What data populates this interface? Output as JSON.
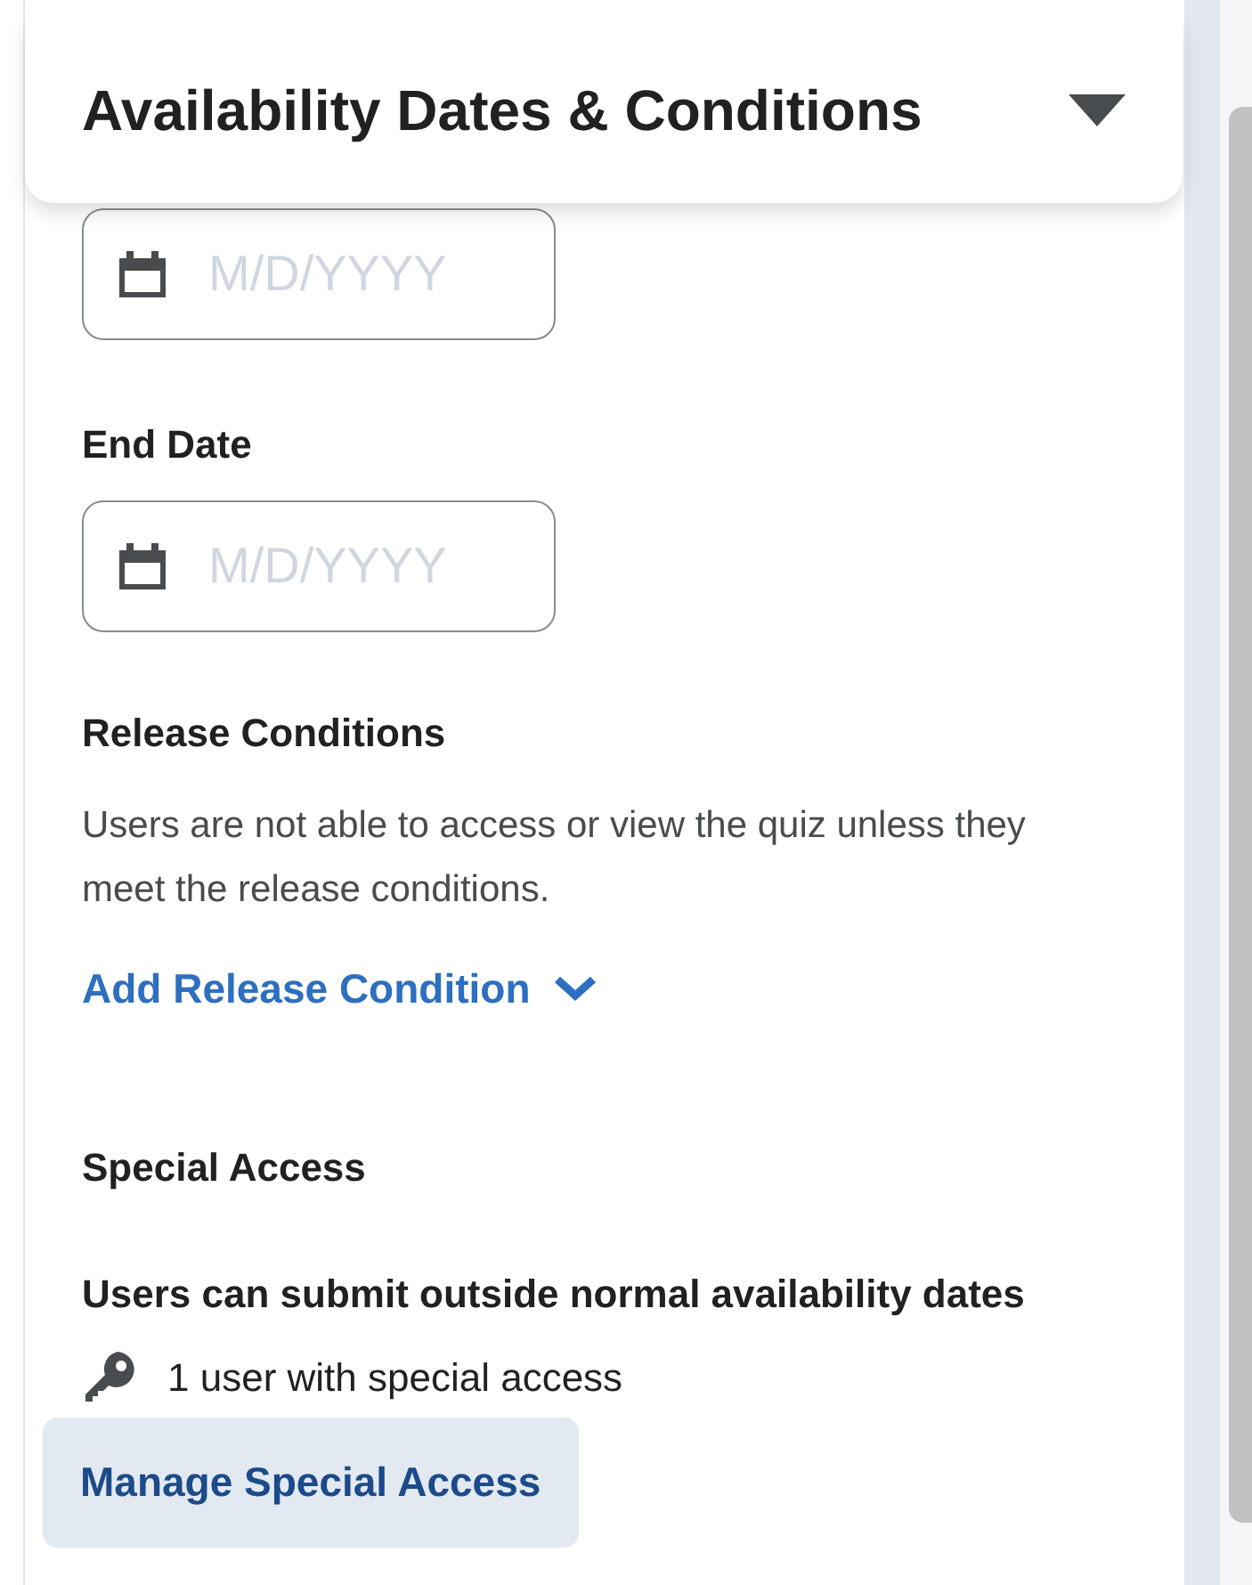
{
  "header": {
    "title": "Availability Dates & Conditions"
  },
  "start_date": {
    "placeholder": "M/D/YYYY"
  },
  "end_date": {
    "label": "End Date",
    "placeholder": "M/D/YYYY"
  },
  "release_conditions": {
    "heading": "Release Conditions",
    "description": "Users are not able to access or view the quiz unless they meet the release conditions.",
    "add_link": "Add Release Condition"
  },
  "special_access": {
    "heading": "Special Access",
    "subheading": "Users can submit outside normal availability dates",
    "count": "1 user with special access",
    "button": "Manage Special Access"
  }
}
